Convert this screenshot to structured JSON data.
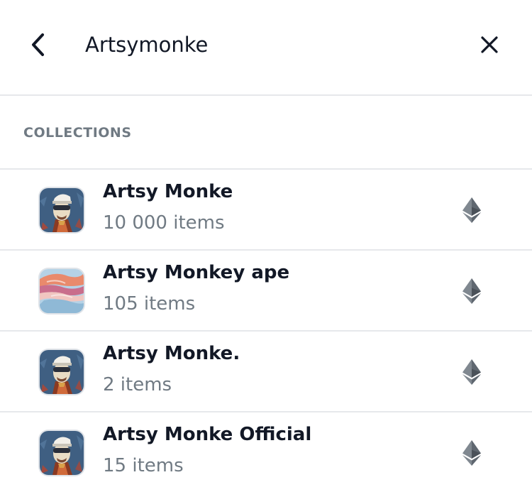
{
  "search": {
    "value": "Artsymonke"
  },
  "icons": {
    "back": "chevron-left-icon",
    "clear": "close-icon",
    "chain": "ethereum-icon"
  },
  "section": {
    "heading": "COLLECTIONS"
  },
  "collections": [
    {
      "name": "Artsy Monke",
      "count": "10 000 items",
      "avatar": "monke-avatar",
      "chain": "ethereum"
    },
    {
      "name": "Artsy Monkey ape",
      "count": "105 items",
      "avatar": "pastel-cloud-avatar",
      "chain": "ethereum"
    },
    {
      "name": "Artsy Monke.",
      "count": "2 items",
      "avatar": "monke-avatar",
      "chain": "ethereum"
    },
    {
      "name": "Artsy Monke Official",
      "count": "15 items",
      "avatar": "monke-avatar",
      "chain": "ethereum"
    }
  ],
  "colors": {
    "text": "#121826",
    "secondary_text": "#707a83",
    "divider": "#e6e8eb",
    "chain_icon": "#808890"
  }
}
